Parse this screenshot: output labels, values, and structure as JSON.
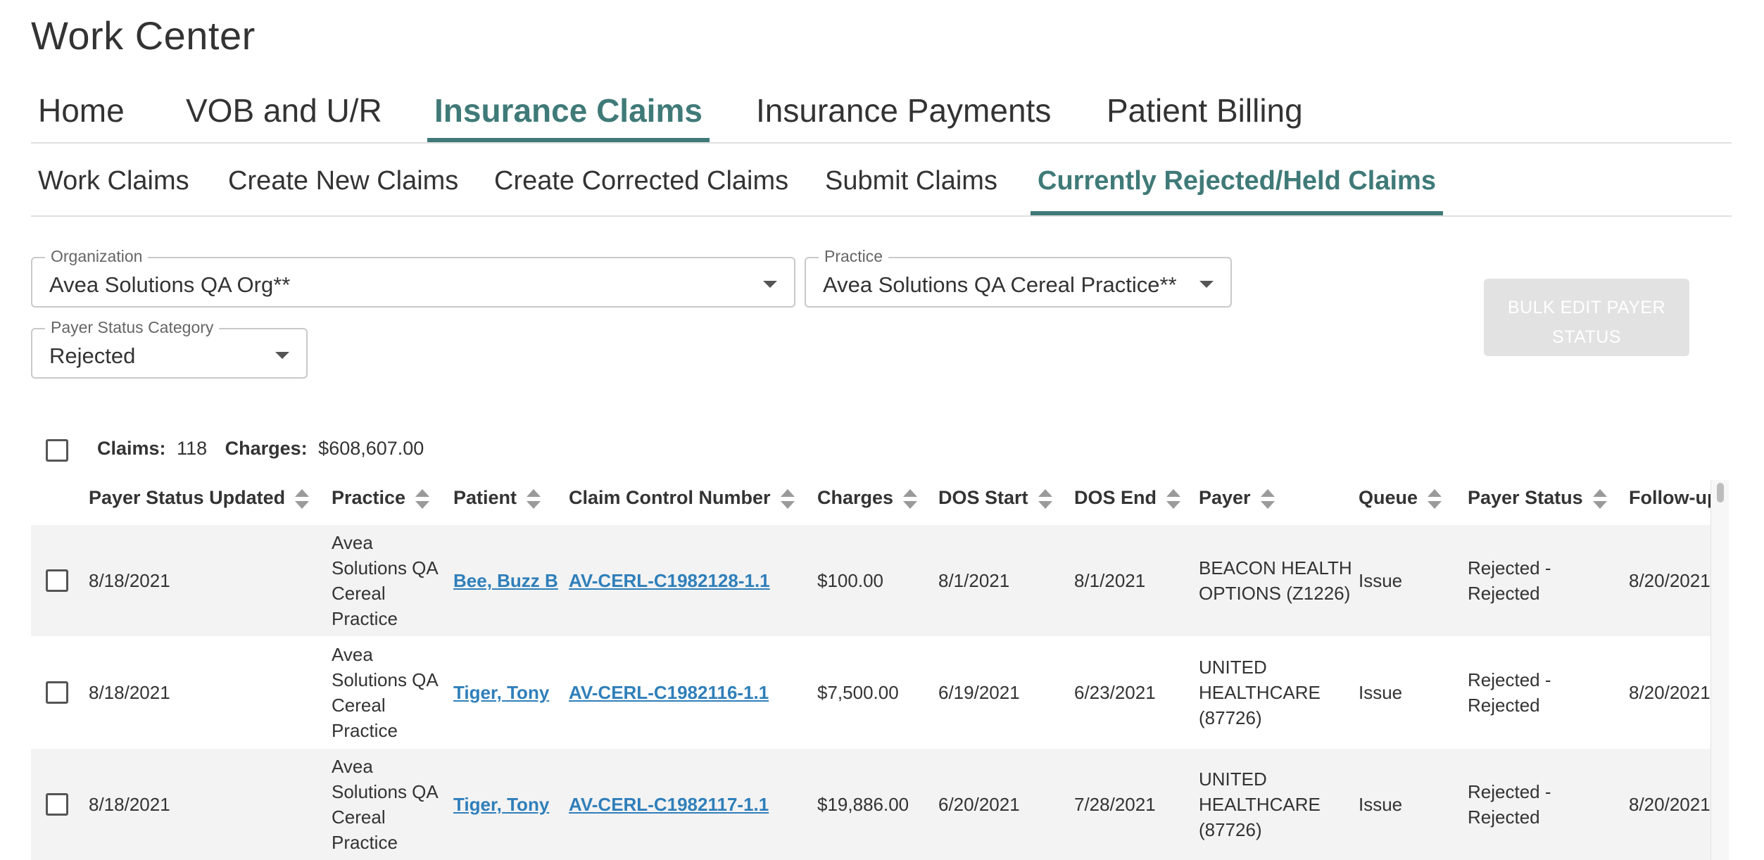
{
  "app": {
    "title": "Work Center"
  },
  "main_tabs": [
    {
      "label": "Home",
      "active": false
    },
    {
      "label": "VOB and U/R",
      "active": false
    },
    {
      "label": "Insurance Claims",
      "active": true
    },
    {
      "label": "Insurance Payments",
      "active": false
    },
    {
      "label": "Patient Billing",
      "active": false
    }
  ],
  "sub_tabs": [
    {
      "label": "Work Claims",
      "active": false
    },
    {
      "label": "Create New Claims",
      "active": false
    },
    {
      "label": "Create Corrected Claims",
      "active": false
    },
    {
      "label": "Submit Claims",
      "active": false
    },
    {
      "label": "Currently Rejected/Held Claims",
      "active": true
    }
  ],
  "filters": {
    "organization": {
      "label": "Organization",
      "value": "Avea Solutions QA Org**"
    },
    "practice": {
      "label": "Practice",
      "value": "Avea Solutions QA Cereal Practice**"
    },
    "payer_status_category": {
      "label": "Payer Status Category",
      "value": "Rejected"
    }
  },
  "bulk_edit": {
    "label_line1": "BULK EDIT PAYER",
    "label_line2": "STATUS",
    "disabled": true
  },
  "summary": {
    "claims_label": "Claims:",
    "claims_value": "118",
    "charges_label": "Charges:",
    "charges_value": "$608,607.00"
  },
  "table": {
    "columns": [
      "Payer Status Updated",
      "Practice",
      "Patient",
      "Claim Control Number",
      "Charges",
      "DOS Start",
      "DOS End",
      "Payer",
      "Queue",
      "Payer Status",
      "Follow-up"
    ],
    "rows": [
      {
        "payer_status_updated": "8/18/2021",
        "practice": [
          "Avea",
          "Solutions QA",
          "Cereal",
          "Practice"
        ],
        "patient": "Bee, Buzz B",
        "claim_control_number": "AV-CERL-C1982128-1.1",
        "charges": "$100.00",
        "dos_start": "8/1/2021",
        "dos_end": "8/1/2021",
        "payer": [
          "BEACON HEALTH",
          "OPTIONS (Z1226)"
        ],
        "queue": "Issue",
        "payer_status": [
          "Rejected -",
          "Rejected"
        ],
        "follow_up": "8/20/2021"
      },
      {
        "payer_status_updated": "8/18/2021",
        "practice": [
          "Avea",
          "Solutions QA",
          "Cereal",
          "Practice"
        ],
        "patient": "Tiger, Tony",
        "claim_control_number": "AV-CERL-C1982116-1.1",
        "charges": "$7,500.00",
        "dos_start": "6/19/2021",
        "dos_end": "6/23/2021",
        "payer": [
          "UNITED",
          "HEALTHCARE",
          "(87726)"
        ],
        "queue": "Issue",
        "payer_status": [
          "Rejected -",
          "Rejected"
        ],
        "follow_up": "8/20/2021"
      },
      {
        "payer_status_updated": "8/18/2021",
        "practice": [
          "Avea",
          "Solutions QA",
          "Cereal",
          "Practice"
        ],
        "patient": "Tiger, Tony",
        "claim_control_number": "AV-CERL-C1982117-1.1",
        "charges": "$19,886.00",
        "dos_start": "6/20/2021",
        "dos_end": "7/28/2021",
        "payer": [
          "UNITED",
          "HEALTHCARE",
          "(87726)"
        ],
        "queue": "Issue",
        "payer_status": [
          "Rejected -",
          "Rejected"
        ],
        "follow_up": "8/20/2021"
      }
    ]
  },
  "colors": {
    "accent": "#3f7a78",
    "link": "#2f7fba",
    "row_shade": "#f3f3f3",
    "disabled_button": "#e2e2e2"
  },
  "icons": {
    "dropdown": "caret-down-icon",
    "sort": "sort-icon"
  }
}
